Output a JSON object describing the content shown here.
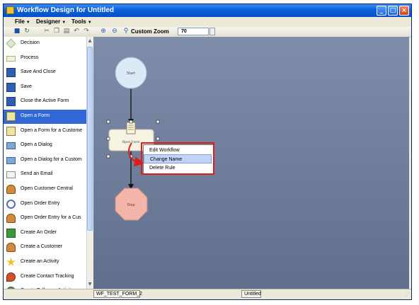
{
  "window": {
    "title": "Workflow Design for Untitled"
  },
  "menu": [
    {
      "label": "File"
    },
    {
      "label": "Designer"
    },
    {
      "label": "Tools"
    }
  ],
  "toolbar": {
    "zoom_label": "Custom Zoom",
    "zoom_value": "70"
  },
  "sidebar": {
    "items": [
      {
        "label": "Decision",
        "icon": "diamond-icon"
      },
      {
        "label": "Process",
        "icon": "rectangle-icon"
      },
      {
        "label": "Save And Close",
        "icon": "floppy-disk-icon"
      },
      {
        "label": "Save",
        "icon": "floppy-disk-icon"
      },
      {
        "label": "Close the Active Form",
        "icon": "floppy-disk-icon"
      },
      {
        "label": "Open a Form",
        "icon": "form-icon"
      },
      {
        "label": "Open a Form for a Custome",
        "icon": "form-icon"
      },
      {
        "label": "Open a Dialog",
        "icon": "dialog-icon"
      },
      {
        "label": "Open a Dialog for a Custom",
        "icon": "dialog-icon"
      },
      {
        "label": "Send an Email",
        "icon": "envelope-icon"
      },
      {
        "label": "Open Customer Central",
        "icon": "person-icon"
      },
      {
        "label": "Open Order Entry",
        "icon": "search-icon"
      },
      {
        "label": "Open Order Entry for a Cus",
        "icon": "person-icon"
      },
      {
        "label": "Create An Order",
        "icon": "plus-icon"
      },
      {
        "label": "Create a Customer",
        "icon": "person-icon"
      },
      {
        "label": "Create an Activity",
        "icon": "star-icon"
      },
      {
        "label": "Create Contact Tracking",
        "icon": "pin-icon"
      },
      {
        "label": "Create Followup Activity",
        "icon": "group-icon"
      }
    ],
    "selected_index": 5
  },
  "diagram": {
    "start_label": "Start",
    "form_label": "Open Form",
    "stop_label": "Stop"
  },
  "context_menu": {
    "items": [
      {
        "label": "Edit Workflow"
      },
      {
        "label": "Change Name"
      },
      {
        "label": "Delete Rule"
      }
    ],
    "highlighted_index": 1
  },
  "status": {
    "left": "WF_TEST_FORM_2",
    "middle": "Untitled"
  },
  "colors": {
    "title_bar": "#0a5fd8",
    "selection": "#3168d5",
    "canvas": "#6f7f9c",
    "start_node": "#dce9f7",
    "stop_node": "#f3b4aa",
    "annotation": "#e21a1a"
  }
}
